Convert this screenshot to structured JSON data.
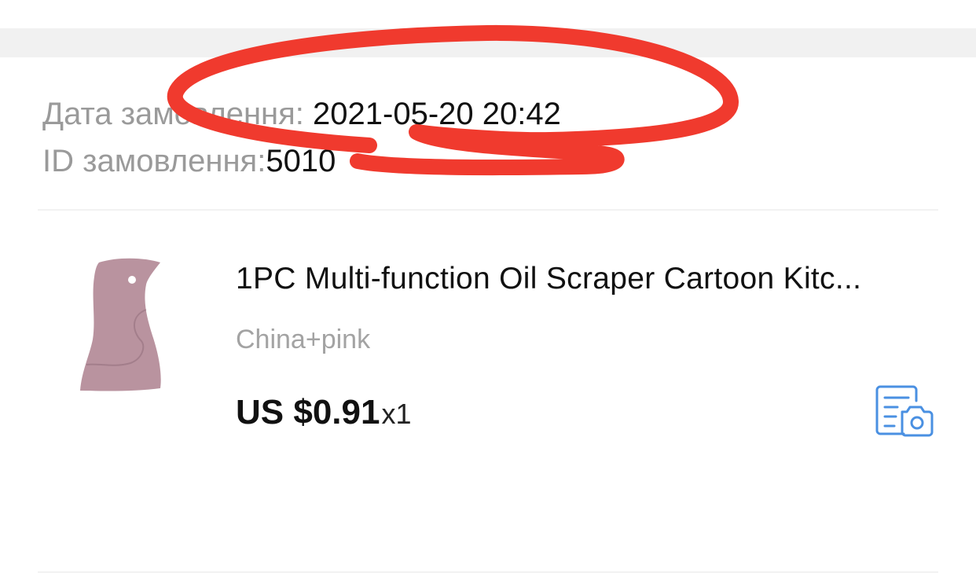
{
  "order": {
    "date_label": "Дата замовлення: ",
    "date_value": "2021-05-20 20:42",
    "id_label": "ID замовлення:",
    "id_value_partial": "5010"
  },
  "annotation": {
    "color": "#f03a2e"
  },
  "product": {
    "title": "1PC Multi-function Oil Scraper Cartoon Kitc...",
    "variant": "China+pink",
    "price": "US $0.91",
    "quantity": "x1",
    "image_color": "#b9939f",
    "image_description_icon": "penguin-scraper-image"
  },
  "actions": {
    "review_icon": "document-camera-icon",
    "review_icon_color": "#4a90e2"
  }
}
